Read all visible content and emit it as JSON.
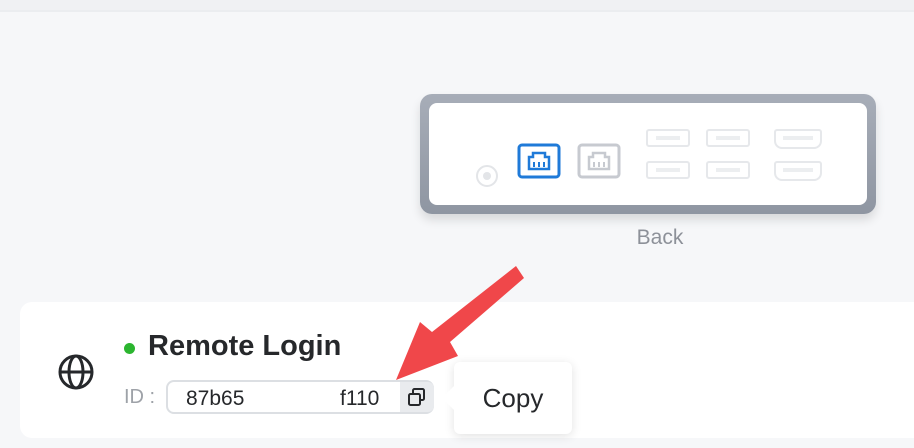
{
  "device": {
    "label": "Back",
    "active_port_color": "#1f7ad8",
    "inactive_port_color": "#c7cad0"
  },
  "remote_login": {
    "title": "Remote Login",
    "status_color": "#2bb52f",
    "id_label": "ID :",
    "id_prefix": "87b65",
    "id_suffix": "f110",
    "copy_tooltip": "Copy"
  },
  "annotation": {
    "arrow_color": "#f0474a"
  },
  "icons": [
    "globe-icon",
    "copy-icon",
    "ethernet-port-icon",
    "power-port-icon",
    "usb-port-icon",
    "hdmi-port-icon"
  ]
}
